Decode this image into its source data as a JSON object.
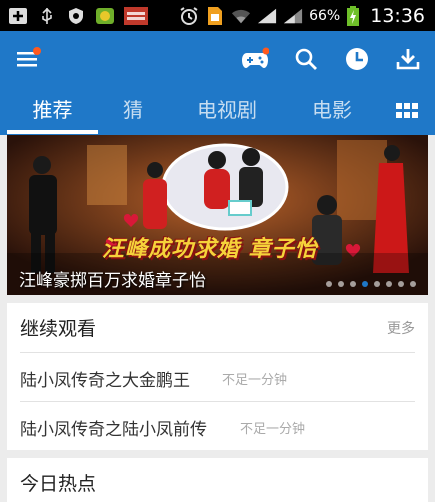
{
  "status_bar": {
    "battery": "66%",
    "time": "13:36"
  },
  "app_bar": {
    "icons": [
      "menu-icon",
      "game-controller-icon",
      "search-icon",
      "history-icon",
      "download-icon"
    ]
  },
  "tabs": [
    {
      "label": "推荐",
      "active": true
    },
    {
      "label": "猜",
      "active": false
    },
    {
      "label": "电视剧",
      "active": false
    },
    {
      "label": "电影",
      "active": false
    }
  ],
  "banner": {
    "caption": "汪峰豪掷百万求婚章子怡",
    "overlay_title": "汪峰成功求婚 章子怡",
    "dots_total": 8,
    "dots_active": 3
  },
  "continue_watching": {
    "title": "继续观看",
    "more": "更多",
    "items": [
      {
        "title": "陆小凤传奇之大金鹏王",
        "progress": "不足一分钟"
      },
      {
        "title": "陆小凤传奇之陆小凤前传",
        "progress": "不足一分钟"
      }
    ]
  },
  "hot_today": {
    "title": "今日热点"
  },
  "colors": {
    "accent": "#1f78c8",
    "notification_dot": "#ff5a1f"
  }
}
